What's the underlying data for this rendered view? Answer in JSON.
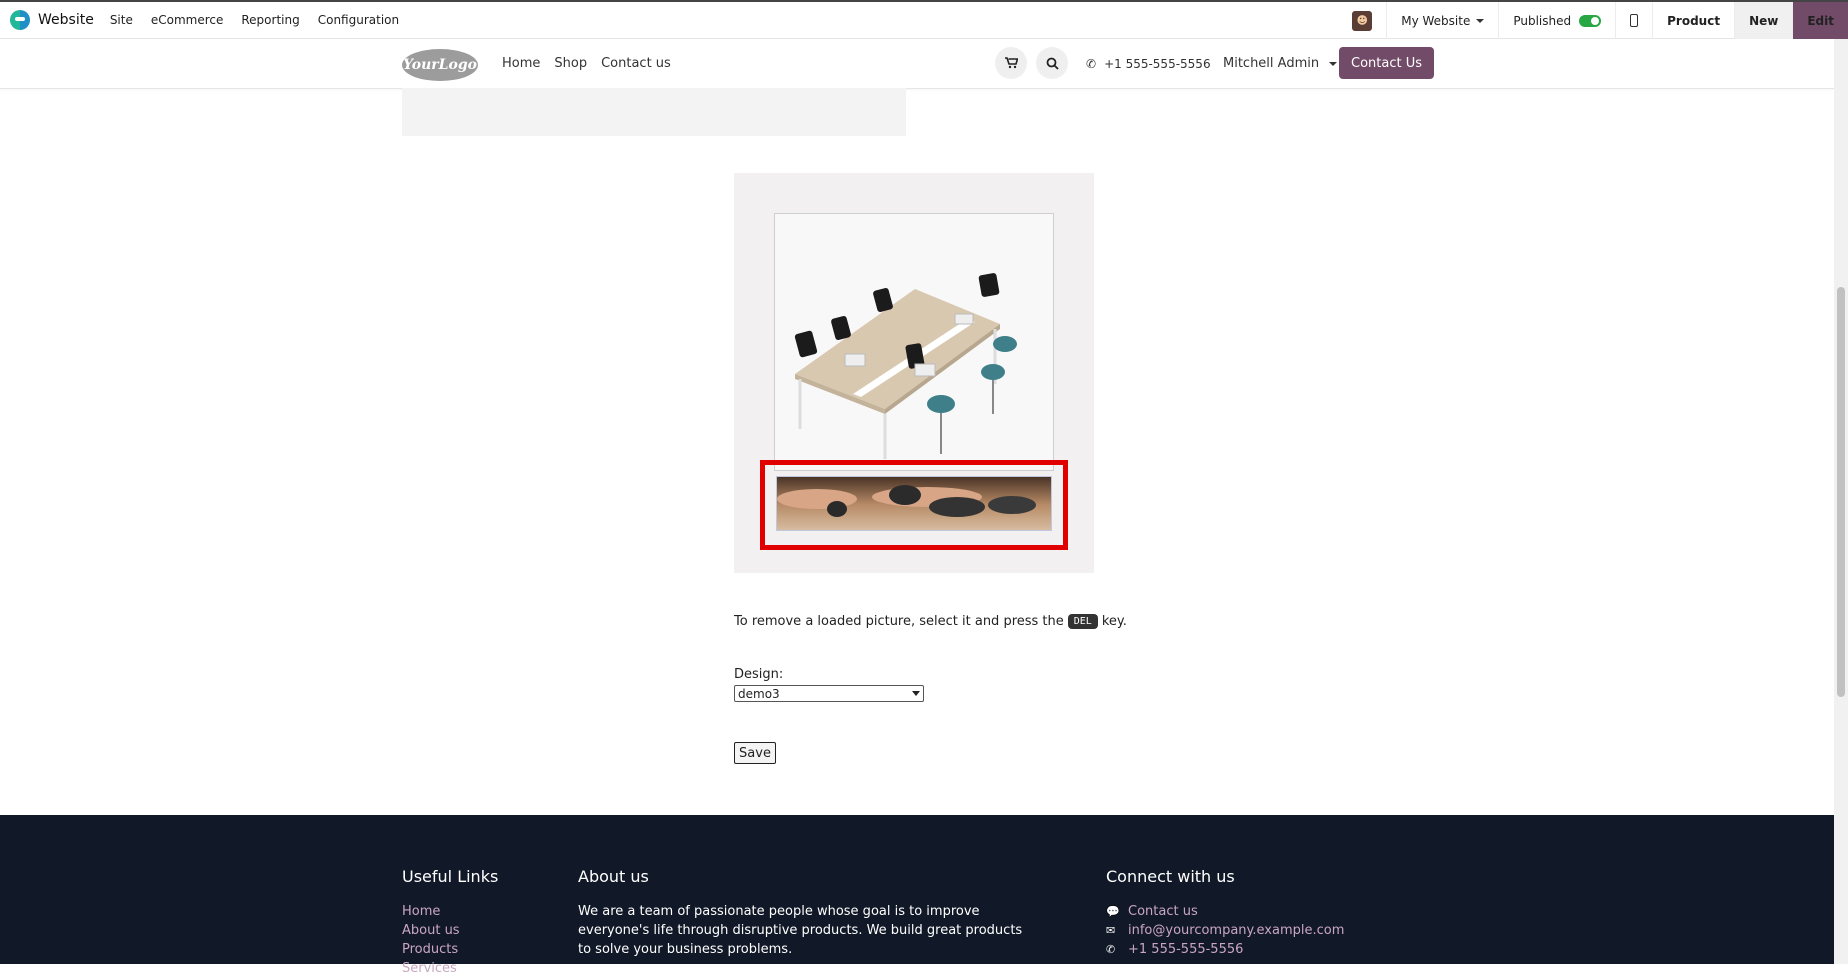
{
  "topbar": {
    "brand": "Website",
    "menu": [
      "Site",
      "eCommerce",
      "Reporting",
      "Configuration"
    ],
    "my_website": "My Website",
    "published": "Published",
    "product": "Product",
    "new": "New",
    "edit": "Edit"
  },
  "nav": {
    "logo": "YourLogo",
    "links": [
      "Home",
      "Shop",
      "Contact us"
    ],
    "phone": "+1 555-555-5556",
    "user": "Mitchell Admin",
    "contact_button": "Contact Us"
  },
  "main": {
    "hint_before": "To remove a loaded picture, select it and press the",
    "hint_key": "DEL",
    "hint_after": "key.",
    "design_label": "Design:",
    "design_value": "demo3",
    "save_label": "Save"
  },
  "footer": {
    "useful_links_title": "Useful Links",
    "useful_links": [
      "Home",
      "About us",
      "Products",
      "Services"
    ],
    "about_title": "About us",
    "about_lines": [
      "We are a team of passionate people whose goal is to improve",
      "everyone's life through disruptive products. We build great products",
      "to solve your business problems."
    ],
    "connect_title": "Connect with us",
    "connect_contact": "Contact us",
    "connect_email": "info@yourcompany.example.com",
    "connect_phone": "+1 555-555-5556"
  },
  "colors": {
    "brand": "#714b67",
    "footer_bg": "#111827",
    "highlight": "#e00000",
    "link": "#c9a6c1"
  }
}
